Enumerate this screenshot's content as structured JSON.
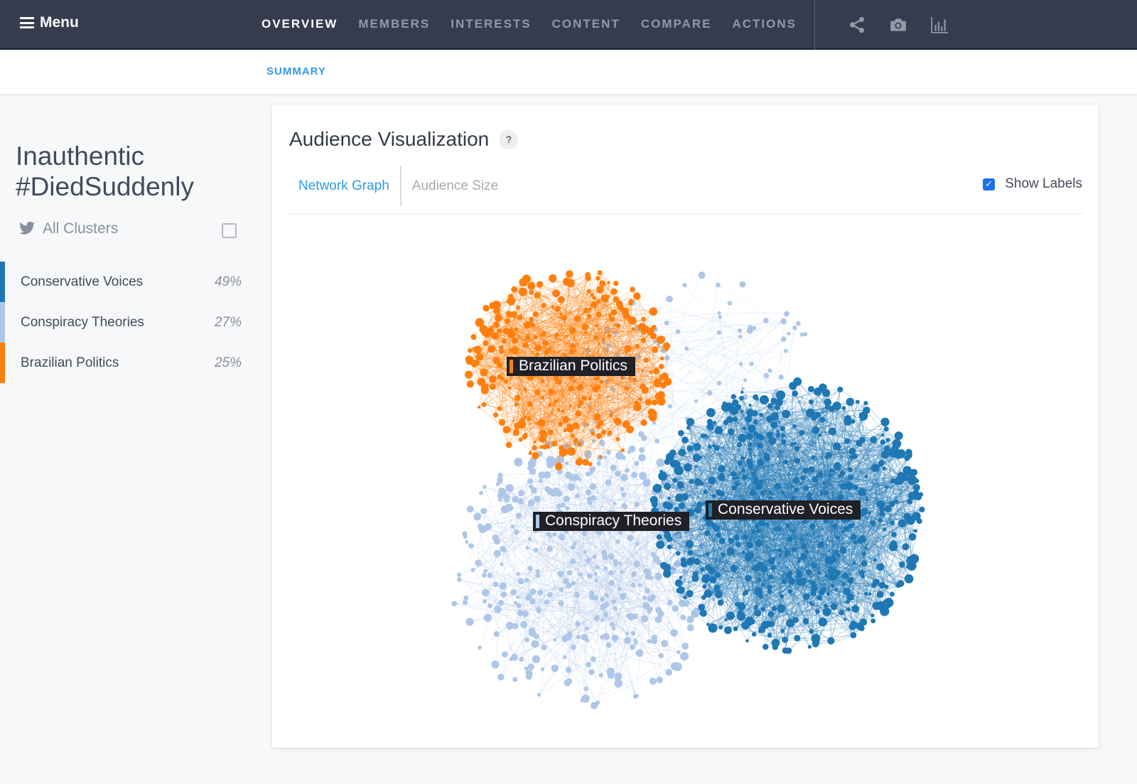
{
  "topbar": {
    "menu_label": "Menu",
    "nav": [
      "OVERVIEW",
      "MEMBERS",
      "INTERESTS",
      "CONTENT",
      "COMPARE",
      "ACTIONS"
    ],
    "active": "OVERVIEW",
    "icons": [
      "share-icon",
      "camera-icon",
      "bar-chart-icon"
    ]
  },
  "subnav": {
    "summary": "SUMMARY"
  },
  "sidebar": {
    "title_line1": "Inauthentic",
    "title_line2": "#DiedSuddenly",
    "all_clusters": "All Clusters",
    "clusters": [
      {
        "label": "Conservative Voices",
        "pct": "49%",
        "color": "#1f77b4"
      },
      {
        "label": "Conspiracy Theories",
        "pct": "27%",
        "color": "#aec7e8"
      },
      {
        "label": "Brazilian Politics",
        "pct": "25%",
        "color": "#ff7f0e"
      }
    ]
  },
  "card": {
    "title": "Audience Visualization",
    "help": "?",
    "tabs": [
      "Network Graph",
      "Audience Size"
    ],
    "show_labels": "Show Labels",
    "show_labels_checked": true
  },
  "graph": {
    "labels": [
      "Brazilian Politics",
      "Conspiracy Theories",
      "Conservative Voices"
    ]
  }
}
